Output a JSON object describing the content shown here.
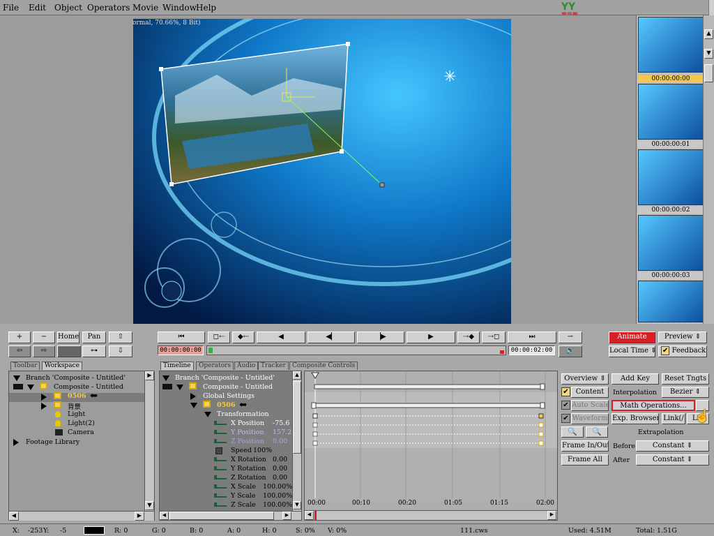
{
  "menu": [
    "File",
    "Edit",
    "Object",
    "Operators",
    "Movie",
    "Window",
    "Help"
  ],
  "logo_text": "YY",
  "logo_subtext": "育华教",
  "viewer": {
    "info_label": "ormal, 70.66%, 8 Bit)"
  },
  "thumbnails": [
    "00:00:00:00",
    "00:00:00:01",
    "00:00:00:02",
    "00:00:00:03"
  ],
  "transport": {
    "left_buttons": [
      "+",
      "−",
      "Home",
      "Pan"
    ],
    "timecode_start": "00:00:00:00",
    "timecode_end": "00:00:02:00"
  },
  "right_buttons": {
    "animate": "Animate",
    "preview": "Preview",
    "local_time": "Local Time",
    "feedback": "Feedback"
  },
  "left_tabs": [
    "Toolbar",
    "Workspace"
  ],
  "workspace_tree": [
    {
      "label": "Branch 'Composite - Untitled'"
    },
    {
      "label": "Composite - Untitled"
    },
    {
      "label": "0506"
    },
    {
      "label": "背景"
    },
    {
      "label": "Light"
    },
    {
      "label": "Light(2)"
    },
    {
      "label": "Camera"
    },
    {
      "label": "Footage Library"
    }
  ],
  "mid_tabs": [
    "Timeline",
    "Operators",
    "Audio",
    "Tracker",
    "Composite Controls"
  ],
  "timeline_tree": {
    "branch": "Branch 'Composite - Untitled'",
    "composite": "Composite - Untitled",
    "global": "Global Settings",
    "layer": "0506",
    "transformation": "Transformation",
    "params": [
      {
        "name": "X Position",
        "value": "-75.6"
      },
      {
        "name": "Y Position",
        "value": "157.2"
      },
      {
        "name": "Z Position",
        "value": "0.00"
      },
      {
        "name": "Speed",
        "value": "100%"
      },
      {
        "name": "X Rotation",
        "value": "0.00"
      },
      {
        "name": "Y Rotation",
        "value": "0.00"
      },
      {
        "name": "Z Rotation",
        "value": "0.00"
      },
      {
        "name": "X Scale",
        "value": "100.00%"
      },
      {
        "name": "Y Scale",
        "value": "100.00%"
      },
      {
        "name": "Z Scale",
        "value": "100.00%"
      }
    ]
  },
  "ruler_ticks": [
    "00:00",
    "00:10",
    "00:20",
    "01:05",
    "01:15",
    "02:00"
  ],
  "controls": {
    "overview": "Overview",
    "add_key": "Add Key",
    "reset_tngts": "Reset Tngts",
    "content": "Content",
    "interpolation": "Interpolation",
    "bezier": "Bezier",
    "auto_scale": "Auto Scale",
    "math_ops": "Math Operations...",
    "waveform": "Waveform",
    "exp_browser": "Exp. Browser",
    "link": "Link(/",
    "link2": "Lin",
    "extrapolation": "Extrapolation",
    "frame_inout": "Frame In/Out",
    "before": "Before",
    "constant1": "Constant",
    "frame_all": "Frame All",
    "after": "After",
    "constant2": "Constant"
  },
  "status": {
    "x_label": "X: ",
    "x": "-253",
    "y_label": "Y: ",
    "y": "-5",
    "r": "R: 0",
    "g": "G: 0",
    "b": "B: 0",
    "a": "A: 0",
    "h": "H: 0",
    "s": "S: 0%",
    "v": "V: 0%",
    "file": "111.cws",
    "used": "Used: 4.51M",
    "total": "Total: 1.51G"
  },
  "colors": {
    "accent_red": "#d81f26",
    "selection_yellow": "#f2c94c",
    "canvas_blue": "#1a7fd0"
  }
}
